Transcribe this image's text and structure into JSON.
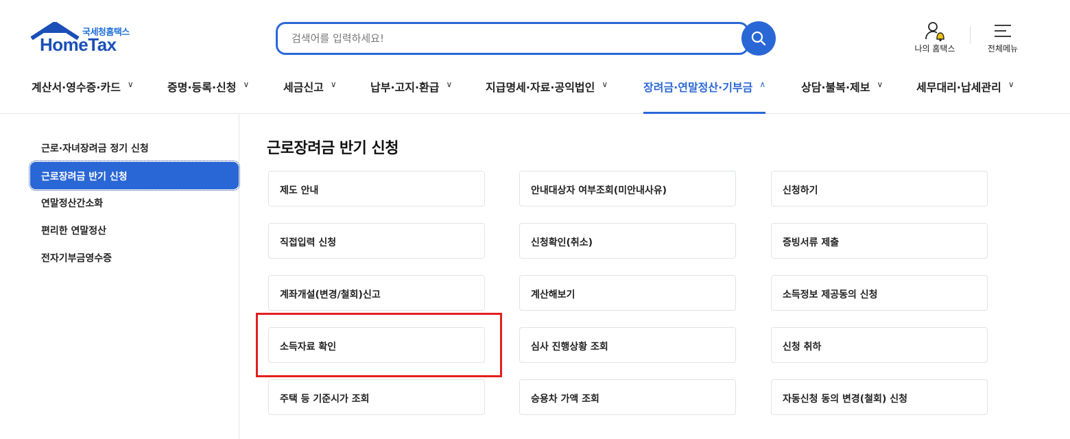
{
  "header": {
    "logo_sub": "국세청홈택스",
    "logo_main": "HomeTax",
    "search_placeholder": "검색어를 입력하세요!",
    "my_hometax_label": "나의 홈택스",
    "all_menu_label": "전체메뉴",
    "brand_color": "#2a67d6"
  },
  "gnb": {
    "items": [
      {
        "label": "계산서·영수증·카드",
        "icon": "chevron-down-icon"
      },
      {
        "label": "증명·등록·신청",
        "icon": "chevron-down-icon"
      },
      {
        "label": "세금신고",
        "icon": "chevron-down-icon"
      },
      {
        "label": "납부·고지·환급",
        "icon": "chevron-down-icon"
      },
      {
        "label": "지급명세·자료·공익법인",
        "icon": "chevron-down-icon"
      },
      {
        "label": "장려금·연말정산·기부금",
        "icon": "chevron-up-icon",
        "active": true
      },
      {
        "label": "상담·불복·제보",
        "icon": "chevron-down-icon"
      },
      {
        "label": "세무대리·납세관리",
        "icon": "chevron-down-icon"
      }
    ]
  },
  "sidebar": {
    "items": [
      {
        "label": "근로·자녀장려금 정기 신청"
      },
      {
        "label": "근로장려금 반기 신청",
        "active": true
      },
      {
        "label": "연말정산간소화"
      },
      {
        "label": "편리한 연말정산"
      },
      {
        "label": "전자기부금영수증"
      }
    ]
  },
  "main": {
    "title": "근로장려금 반기 신청",
    "cards": [
      [
        "제도 안내",
        "안내대상자 여부조회(미안내사유)",
        "신청하기"
      ],
      [
        "직접입력 신청",
        "신청확인(취소)",
        "증빙서류 제출"
      ],
      [
        "계좌개설(변경/철회)신고",
        "계산해보기",
        "소득정보 제공동의 신청"
      ],
      [
        "소득자료 확인",
        "심사 진행상황 조회",
        "신청 취하"
      ],
      [
        "주택 등 기준시가 조회",
        "승용차 가액 조회",
        "자동신청 동의 변경(철회) 신청"
      ]
    ],
    "highlight_color": "#e41d1d"
  }
}
